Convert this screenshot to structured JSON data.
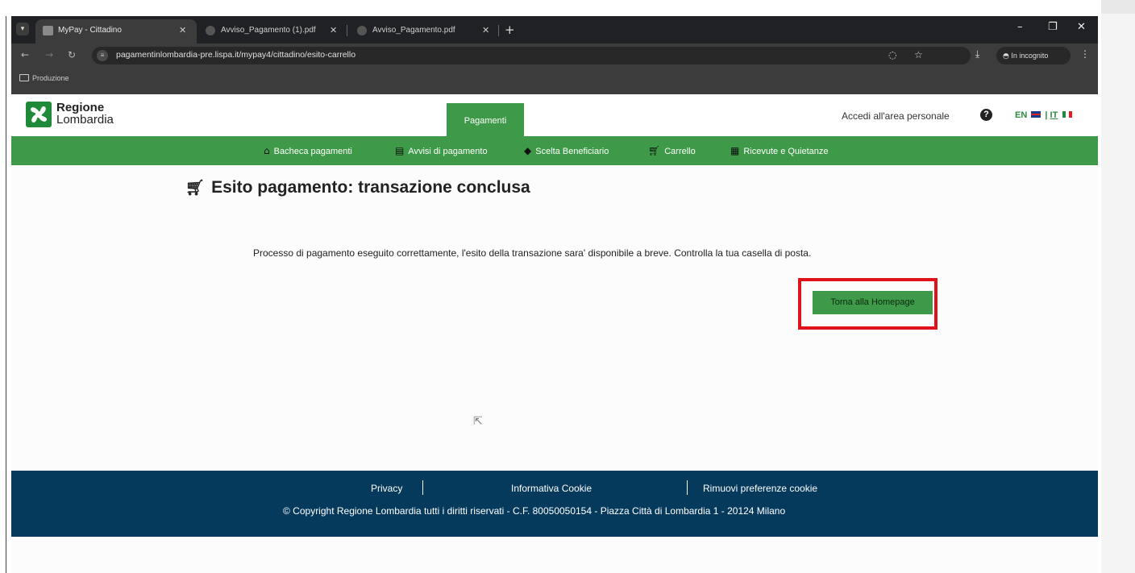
{
  "browser": {
    "tabs": [
      {
        "label": "MyPay - Cittadino",
        "active": true
      },
      {
        "label": "Avviso_Pagamento (1).pdf",
        "active": false
      },
      {
        "label": "Avviso_Pagamento.pdf",
        "active": false
      }
    ],
    "new_tab": "+",
    "url": "pagamentinlombardia-pre.lispa.it/mypay4/cittadino/esito-carrello",
    "incognito_label": "In incognito",
    "bookmark_folder": "Produzione"
  },
  "header": {
    "logo_line1": "Regione",
    "logo_line2": "Lombardia",
    "active_tab": "Pagamenti",
    "login_link": "Accedi all'area personale",
    "lang_en": "EN",
    "lang_sep": "|",
    "lang_it": "IT"
  },
  "nav": {
    "items": [
      {
        "label": "Bacheca pagamenti",
        "icon": "home-icon"
      },
      {
        "label": "Avvisi di pagamento",
        "icon": "document-icon"
      },
      {
        "label": "Scelta Beneficiario",
        "icon": "tag-icon"
      },
      {
        "label": "Carrello",
        "icon": "cart-icon"
      },
      {
        "label": "Ricevute e Quietanze",
        "icon": "receipt-icon"
      }
    ]
  },
  "main": {
    "title": "Esito pagamento: transazione conclusa",
    "message": "Processo di pagamento eseguito correttamente, l'esito della transazione sara' disponibile a breve. Controlla la tua casella di posta.",
    "home_button": "Torna alla Homepage",
    "highlight_color": "#e0121a"
  },
  "footer": {
    "links": [
      "Privacy",
      "Informativa Cookie",
      "Rimuovi preferenze cookie"
    ],
    "copyright": "© Copyright Regione Lombardia tutti i diritti riservati - C.F. 80050050154 - Piazza Città di Lombardia 1 - 20124 Milano"
  },
  "colors": {
    "brand_green": "#3e9a48",
    "footer_blue": "#063a5c"
  }
}
